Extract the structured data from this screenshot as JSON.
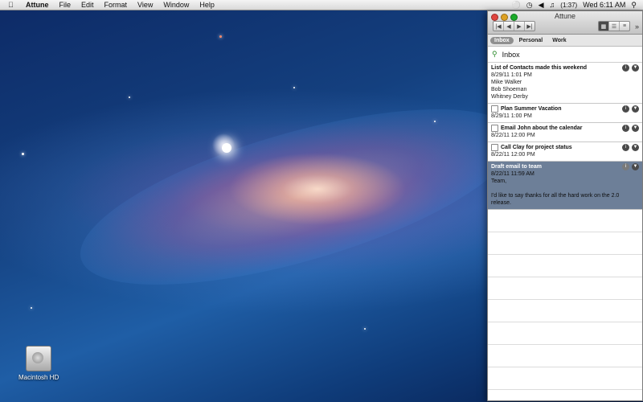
{
  "menubar": {
    "app_name": "Attune",
    "menus": [
      "File",
      "Edit",
      "Format",
      "View",
      "Window",
      "Help"
    ],
    "battery": "(1:37)",
    "clock": "Wed 6:11 AM"
  },
  "window": {
    "title": "Attune",
    "tabs": [
      {
        "label": "Inbox",
        "active": true
      },
      {
        "label": "Personal",
        "active": false
      },
      {
        "label": "Work",
        "active": false
      }
    ],
    "list_header": "Inbox"
  },
  "notes": [
    {
      "title": "List of Contacts made this weekend",
      "date": "8/29/11 1:01 PM",
      "body": [
        "Mike Walker",
        "Bob Shoeman",
        "Whitney Derby"
      ],
      "checkbox": false,
      "selected": false
    },
    {
      "title": "Plan Summer Vacation",
      "date": "8/29/11 1:00 PM",
      "body": [],
      "checkbox": true,
      "selected": false
    },
    {
      "title": "Email John about the calendar",
      "date": "8/22/11 12:00 PM",
      "body": [],
      "checkbox": true,
      "selected": false
    },
    {
      "title": "Call Clay for project status",
      "date": "8/22/11 12:00 PM",
      "body": [],
      "checkbox": true,
      "selected": false
    },
    {
      "title": "Draft email to team",
      "date": "8/22/11 11:59 AM",
      "body": [
        "Team,",
        "",
        "I'd like to say thanks for all the hard work on the 2.0 release."
      ],
      "checkbox": false,
      "selected": true
    }
  ],
  "desktop": {
    "drive_label": "Macintosh HD"
  },
  "colors": {
    "selected_row": "#6d7f98",
    "tab_active": "#8f8f8f"
  },
  "icons": [
    "apple-icon",
    "search-icon",
    "wifi-icon",
    "volume-icon",
    "info-icon",
    "chevron-down-icon"
  ]
}
